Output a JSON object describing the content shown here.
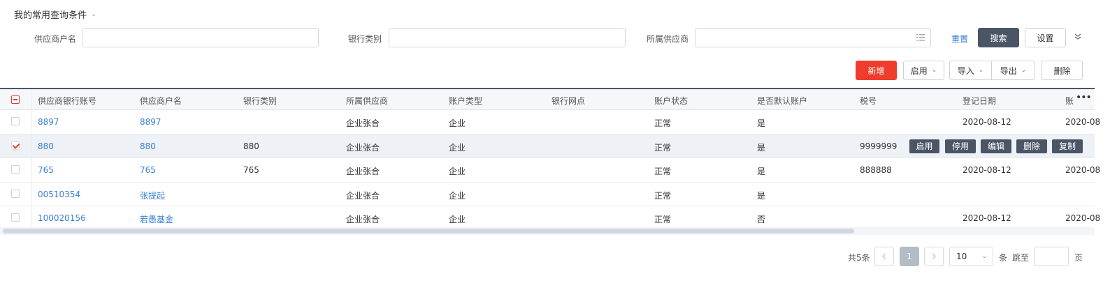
{
  "saved_query": {
    "label": "我的常用查询条件",
    "chevron": "chevron-down-icon"
  },
  "filters": {
    "supplier_name_label": "供应商户名",
    "bank_type_label": "银行类别",
    "owner_supplier_label": "所属供应商",
    "supplier_name_value": "",
    "bank_type_value": "",
    "owner_supplier_value": "",
    "reset": "重置",
    "search": "搜索",
    "settings": "设置"
  },
  "actions": {
    "add": "新增",
    "enable": "启用",
    "import": "导入",
    "export": "导出",
    "delete": "删除"
  },
  "table": {
    "headers": [
      "供应商银行账号",
      "供应商户名",
      "银行类别",
      "所属供应商",
      "账户类型",
      "银行网点",
      "账户状态",
      "是否默认账户",
      "税号",
      "登记日期",
      "账"
    ],
    "rows": [
      {
        "account": "8897",
        "name": "8897",
        "bank": "",
        "owner": "企业张合",
        "type": "企业",
        "branch": "",
        "status": "正常",
        "default": "是",
        "tax": "",
        "date": "2020-08-12",
        "extra": "2020-08",
        "checked": false
      },
      {
        "account": "880",
        "name": "880",
        "bank": "880",
        "owner": "企业张合",
        "type": "企业",
        "branch": "",
        "status": "正常",
        "default": "是",
        "tax": "9999999",
        "date": "",
        "extra": "",
        "checked": true
      },
      {
        "account": "765",
        "name": "765",
        "bank": "765",
        "owner": "企业张合",
        "type": "企业",
        "branch": "",
        "status": "正常",
        "default": "是",
        "tax": "888888",
        "date": "2020-08-12",
        "extra": "2020-08",
        "checked": false
      },
      {
        "account": "00510354",
        "name": "张提起",
        "bank": "",
        "owner": "企业张合",
        "type": "企业",
        "branch": "",
        "status": "正常",
        "default": "是",
        "tax": "",
        "date": "",
        "extra": "",
        "checked": false
      },
      {
        "account": "100020156",
        "name": "若愚基金",
        "bank": "",
        "owner": "企业张合",
        "type": "企业",
        "branch": "",
        "status": "正常",
        "default": "否",
        "tax": "",
        "date": "2020-08-12",
        "extra": "2020-08",
        "checked": false
      }
    ],
    "row_actions": [
      "启用",
      "停用",
      "编辑",
      "删除",
      "复制"
    ]
  },
  "pagination": {
    "total": "共5条",
    "current_page": "1",
    "page_size": "10",
    "page_size_unit": "条",
    "jump_label": "跳至",
    "jump_unit": "页",
    "prev": "<",
    "next": ">"
  },
  "colors": {
    "primary_dark": "#4a5566",
    "danger": "#f03c2c",
    "link": "#3a7fd5"
  }
}
